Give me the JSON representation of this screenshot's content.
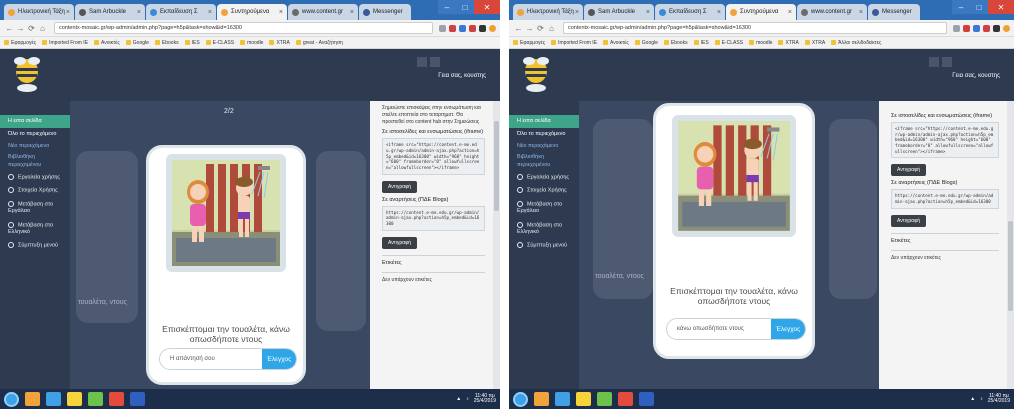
{
  "browser": {
    "tabs": [
      {
        "label": "Ηλεκτρονική Τάξη",
        "fav": "#f2a23a"
      },
      {
        "label": "Sam Arbuckle",
        "fav": "#555555"
      },
      {
        "label": "Εκπαίδευση Σ",
        "fav": "#3b8ad8"
      },
      {
        "label": "Συντηρούμενα",
        "fav": "#f2a23a"
      },
      {
        "label": "www.content.gr",
        "fav": "#6b6b6b"
      },
      {
        "label": "Messenger",
        "fav": "#3b5998"
      }
    ],
    "url_left": "contentx-mosaic.gr/wp-admin/admin.php?page=h5p&task=show&id=16300",
    "url_right": "contentx-mosaic.gr/wp-admin/admin.php?page=h5p&task=show&id=16300",
    "bookmarks": [
      "Εφαρμογές",
      "Imported From IE",
      "Ανοικτές",
      "Google",
      "Ebooks",
      "IES",
      "E-CLASS",
      "moodle",
      "XTRA",
      "great - Αναζήτηση",
      "XTRA",
      "Άλλοι σελιδοδείκτες"
    ]
  },
  "header": {
    "user_label": "Γεια σας, κουστης"
  },
  "sidebar": {
    "active_label": "Η ειπα σελίδα",
    "items": [
      {
        "label": "Όλο το περιεχόμενο",
        "kind": "head"
      },
      {
        "label": "Νέο περιεχόμενο",
        "kind": "sub"
      },
      {
        "label": "Βιβλιοθήκη περιεχομένου",
        "kind": "sub"
      },
      {
        "label": "Εργαλεία χρήσης",
        "kind": "icon"
      },
      {
        "label": "Στοιχεία Χρήσης",
        "kind": "icon"
      },
      {
        "label": "Μετάβαση στο Εργάλειο",
        "kind": "icon"
      },
      {
        "label": "Μετάβαση στο Ελληνικό",
        "kind": "icon"
      },
      {
        "label": "Σύμπτυξη μενού",
        "kind": "icon"
      }
    ]
  },
  "stage": {
    "counter": "2/2",
    "caption": "Επισκέπτομαι την τουαλέτα, κάνω οπωσδήποτε ντους",
    "answer_placeholder": "Η απάντησή σου",
    "answer_value": "κάνω οπωσδήποτε ντους",
    "check_label": "Έλεγχος",
    "side_caption": "τουαλέτα, ντους"
  },
  "panel": {
    "intro": "Σημειώστε επισκέψεις στην ενσωμάτωση και στείλτε εποπτεία στο τεταρτηματ. Θα προστεθεί στο content hub στην Σημειώσεις",
    "embed_label": "Σε ιστοσελίδες και ενσωματώσεις (iframe)",
    "embed_code": "<iframe src=\"https://content.e-me.edu.gr/wp-admin/admin-ajax.php?action=h5p_embed&id=16300\" width=\"960\" height=\"600\" frameborder=\"0\" allowfullscreen=\"allowfullscreen\"></iframe>",
    "copy_label": "Αντιγραφή",
    "direct_label": "Σε αναρτήσεις (ΠΔΕ Blogs)",
    "direct_code": "https://content.e-me.edu.gr/wp-admin/admin-ajax.php?action=h5p_embed&id=16300",
    "tags_label": "Ετικέτες",
    "tags_value": "Δεν υπάρχουν ετικέτες"
  },
  "taskbar": {
    "apps": [
      "#f2a23a",
      "#3fa0e6",
      "#f5d33a",
      "#6cc24a",
      "#e54b3c",
      "#2f5fbf"
    ],
    "time": "11:40 πμ",
    "date": "25/4/2019"
  },
  "colors": {
    "accent_green": "#3fa58a",
    "check_blue": "#2ea6e8",
    "app_navy": "#2d3a4f"
  }
}
